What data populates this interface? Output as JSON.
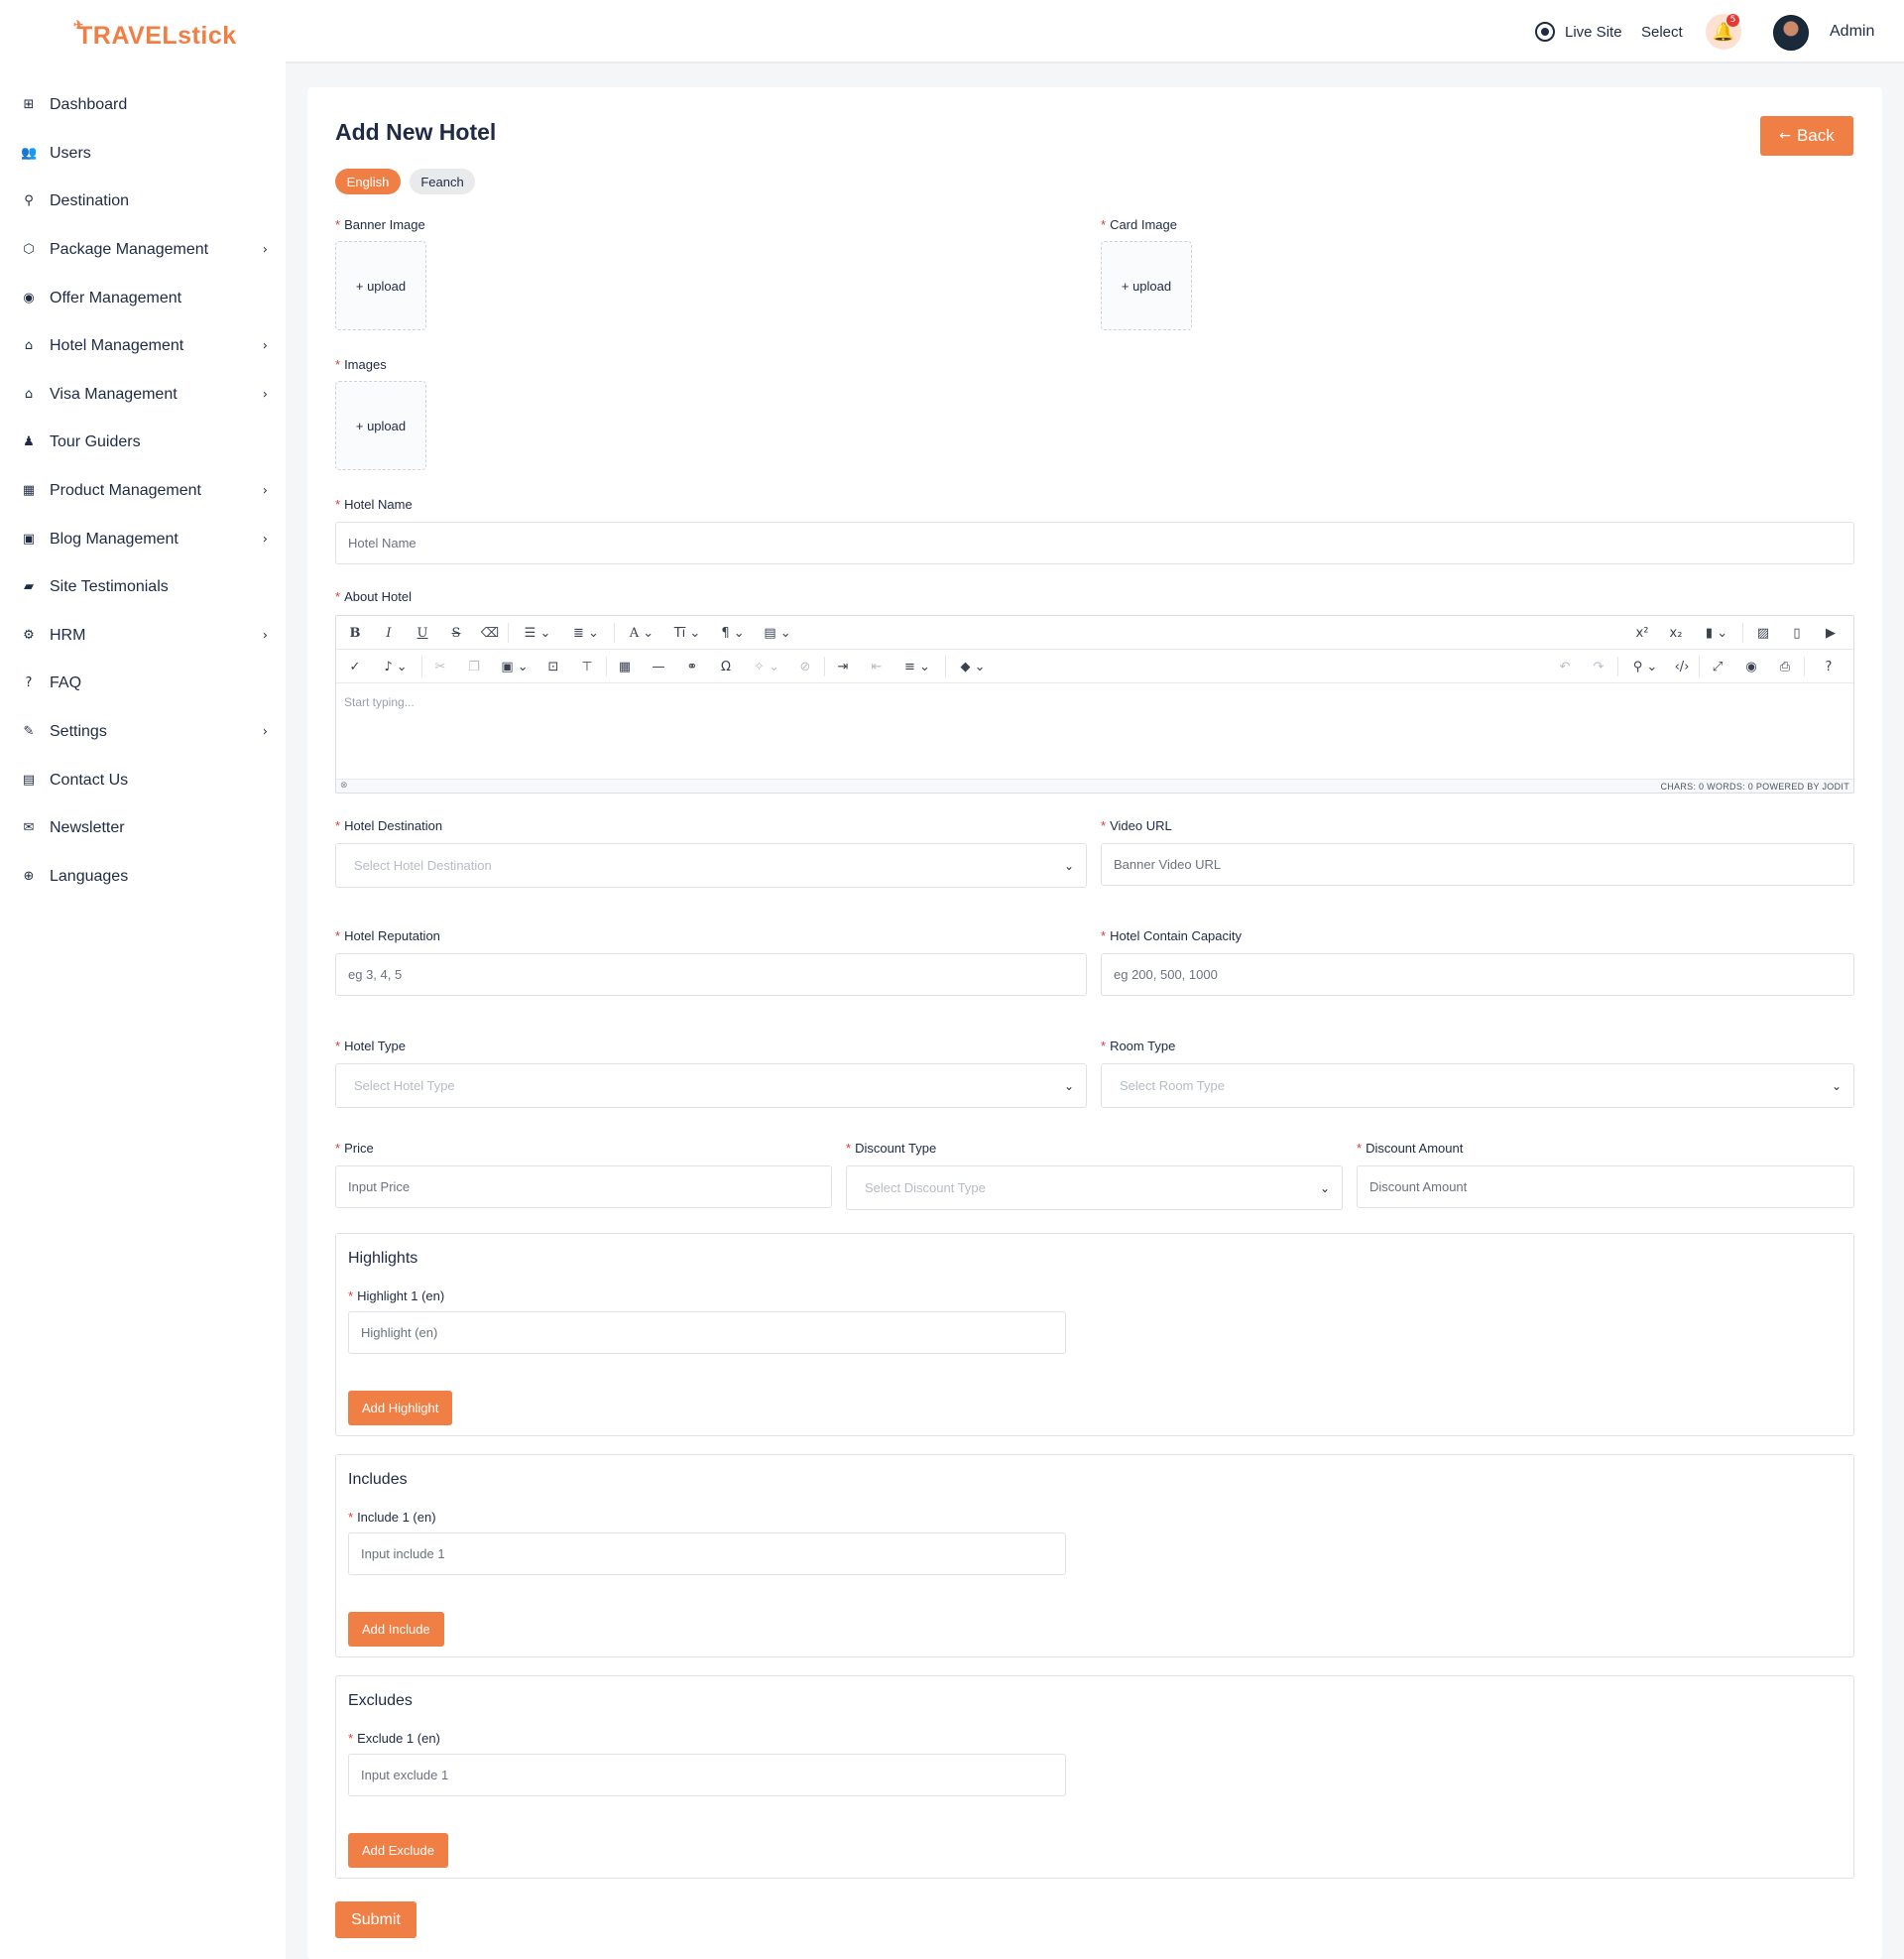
{
  "brand": {
    "logo_text": "TRAVELstick"
  },
  "sidebar": {
    "items": [
      {
        "label": "Dashboard",
        "icon": "dashboard-icon",
        "glyph": "⊞",
        "has_children": false
      },
      {
        "label": "Users",
        "icon": "users-icon",
        "glyph": "👥",
        "has_children": false
      },
      {
        "label": "Destination",
        "icon": "location-pin-icon",
        "glyph": "⚲",
        "has_children": false
      },
      {
        "label": "Package Management",
        "icon": "package-icon",
        "glyph": "⬡",
        "has_children": true
      },
      {
        "label": "Offer Management",
        "icon": "offer-icon",
        "glyph": "◉",
        "has_children": false
      },
      {
        "label": "Hotel Management",
        "icon": "hotel-icon",
        "glyph": "⌂",
        "has_children": true
      },
      {
        "label": "Visa Management",
        "icon": "visa-icon",
        "glyph": "⌂",
        "has_children": true
      },
      {
        "label": "Tour Guiders",
        "icon": "guide-icon",
        "glyph": "♟",
        "has_children": false
      },
      {
        "label": "Product Management",
        "icon": "grid-icon",
        "glyph": "▦",
        "has_children": true
      },
      {
        "label": "Blog Management",
        "icon": "blog-icon",
        "glyph": "▣",
        "has_children": true
      },
      {
        "label": "Site Testimonials",
        "icon": "comment-icon",
        "glyph": "▰",
        "has_children": false
      },
      {
        "label": "HRM",
        "icon": "hrm-icon",
        "glyph": "⚙",
        "has_children": true
      },
      {
        "label": "FAQ",
        "icon": "question-icon",
        "glyph": "?",
        "has_children": false
      },
      {
        "label": "Settings",
        "icon": "wrench-icon",
        "glyph": "✎",
        "has_children": true
      },
      {
        "label": "Contact Us",
        "icon": "contact-card-icon",
        "glyph": "▤",
        "has_children": false
      },
      {
        "label": "Newsletter",
        "icon": "envelope-icon",
        "glyph": "✉",
        "has_children": false
      },
      {
        "label": "Languages",
        "icon": "globe-icon",
        "glyph": "⊕",
        "has_children": false
      }
    ]
  },
  "header": {
    "live_site": "Live Site",
    "select": "Select",
    "notification_count": "5",
    "user_name": "Admin"
  },
  "page": {
    "title": "Add New Hotel",
    "back_label": "Back",
    "languages": [
      "English",
      "Feanch"
    ]
  },
  "form": {
    "banner_image": {
      "label": "Banner Image",
      "upload": "+ upload"
    },
    "card_image": {
      "label": "Card Image",
      "upload": "+ upload"
    },
    "images": {
      "label": "Images",
      "upload": "+ upload"
    },
    "hotel_name": {
      "label": "Hotel Name",
      "placeholder": "Hotel Name"
    },
    "about_hotel": {
      "label": "About Hotel",
      "placeholder": "Start typing...",
      "footer_stats": "CHARS: 0   WORDS: 0   POWERED BY JODIT"
    },
    "hotel_destination": {
      "label": "Hotel Destination",
      "placeholder": "Select Hotel Destination"
    },
    "video_url": {
      "label": "Video URL",
      "placeholder": "Banner Video URL"
    },
    "hotel_reputation": {
      "label": "Hotel Reputation",
      "placeholder": "eg 3, 4, 5"
    },
    "hotel_capacity": {
      "label": "Hotel Contain Capacity",
      "placeholder": "eg 200, 500, 1000"
    },
    "hotel_type": {
      "label": "Hotel Type",
      "placeholder": "Select Hotel Type"
    },
    "room_type": {
      "label": "Room Type",
      "placeholder": "Select Room Type"
    },
    "price": {
      "label": "Price",
      "placeholder": "Input Price"
    },
    "discount_type": {
      "label": "Discount Type",
      "placeholder": "Select Discount Type"
    },
    "discount_amount": {
      "label": "Discount Amount",
      "placeholder": "Discount Amount"
    },
    "highlights": {
      "title": "Highlights",
      "item_label": "Highlight 1 (en)",
      "placeholder": "Highlight (en)",
      "add_label": "Add Highlight"
    },
    "includes": {
      "title": "Includes",
      "item_label": "Include 1 (en)",
      "placeholder": "Input include 1",
      "add_label": "Add Include"
    },
    "excludes": {
      "title": "Excludes",
      "item_label": "Exclude 1 (en)",
      "placeholder": "Input exclude 1",
      "add_label": "Add Exclude"
    },
    "submit_label": "Submit"
  },
  "colors": {
    "accent": "#f07f45",
    "required": "#e53935",
    "text": "#1f2a44"
  }
}
